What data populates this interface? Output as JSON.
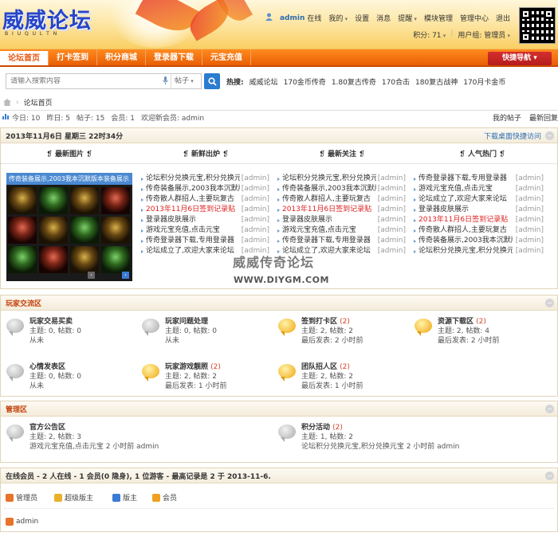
{
  "header": {
    "logo_text": "威威论坛",
    "logo_sub": "B I U Q U L T N",
    "username": "admin",
    "status": "在线",
    "links": [
      "我的",
      "设置",
      "消息",
      "提醒",
      "模块管理",
      "管理中心",
      "退出"
    ],
    "points": "积分: 71",
    "usergroup": "用户组: 管理员"
  },
  "nav": {
    "tabs": [
      "论坛首页",
      "打卡签到",
      "积分商城",
      "登录器下载",
      "元宝充值"
    ],
    "quick_nav": "快捷导航"
  },
  "search": {
    "placeholder": "请输入搜索内容",
    "type": "帖子",
    "hot_label": "热搜:",
    "hot_words": [
      "威威论坛",
      "170金币传奇",
      "1.80复古传奇",
      "170合击",
      "180复古战神",
      "170月卡金币"
    ]
  },
  "breadcrumb": {
    "current": "论坛首页"
  },
  "stats": {
    "today": "今日: 10",
    "yesterday": "昨日: 5",
    "posts": "帖子: 15",
    "members": "会员: 1",
    "welcome": "欢迎新会员: admin",
    "my_posts": "我的帖子",
    "latest": "最新回复"
  },
  "portal": {
    "date": "2013年11月6日 星期三 22时34分",
    "download_link": "下载桌面快捷访问",
    "columns": [
      "最新图片",
      "新鲜出炉",
      "最新关注",
      "人气热门"
    ],
    "pic_caption": "传奇装备展示,2003我本沉默版本装备展示",
    "col1": [
      {
        "t": "论坛积分兑换元宝,积分兑换元宝",
        "a": "[admin]",
        "red": false
      },
      {
        "t": "传奇装备展示,2003我本沉默版本",
        "a": "[admin]",
        "red": false
      },
      {
        "t": "传奇散人群招人,主要玩复古",
        "a": "[admin]",
        "red": false
      },
      {
        "t": "2013年11月6日签到记录贴",
        "a": "[admin]",
        "red": true
      },
      {
        "t": "登录器皮肤展示",
        "a": "[admin]",
        "red": false
      },
      {
        "t": "游戏元宝充值,点击元宝",
        "a": "[admin]",
        "red": false
      },
      {
        "t": "传奇登录器下载,专用登录器",
        "a": "[admin]",
        "red": false
      },
      {
        "t": "论坛成立了,欢迎大家来论坛",
        "a": "[admin]",
        "red": false
      }
    ],
    "col2": [
      {
        "t": "论坛积分兑换元宝,积分兑换元宝",
        "a": "[admin]",
        "red": false
      },
      {
        "t": "传奇装备展示,2003我本沉默版本",
        "a": "[admin]",
        "red": false
      },
      {
        "t": "传奇散人群招人,主要玩复古",
        "a": "[admin]",
        "red": false
      },
      {
        "t": "2013年11月6日签到记录贴",
        "a": "[admin]",
        "red": true
      },
      {
        "t": "登录器皮肤展示",
        "a": "[admin]",
        "red": false
      },
      {
        "t": "游戏元宝充值,点击元宝",
        "a": "[admin]",
        "red": false
      },
      {
        "t": "传奇登录器下载,专用登录器",
        "a": "[admin]",
        "red": false
      },
      {
        "t": "论坛成立了,欢迎大家来论坛",
        "a": "[admin]",
        "red": false
      }
    ],
    "col3": [
      {
        "t": "传奇登录器下载,专用登录器",
        "a": "[admin]",
        "red": false
      },
      {
        "t": "游戏元宝充值,点击元宝",
        "a": "[admin]",
        "red": false
      },
      {
        "t": "论坛成立了,欢迎大家来论坛",
        "a": "[admin]",
        "red": false
      },
      {
        "t": "登录器皮肤展示",
        "a": "[admin]",
        "red": false
      },
      {
        "t": "2013年11月6日签到记录贴",
        "a": "[admin]",
        "red": true
      },
      {
        "t": "传奇散人群招人,主要玩复古",
        "a": "[admin]",
        "red": false
      },
      {
        "t": "传奇装备展示,2003我本沉默版本",
        "a": "[admin]",
        "red": false
      },
      {
        "t": "论坛积分兑换元宝,积分兑换元宝",
        "a": "[admin]",
        "red": false
      }
    ]
  },
  "watermark": {
    "line1": "威威传奇论坛",
    "line2": "WWW.DIYGM.COM"
  },
  "player_zone": {
    "title": "玩家交流区",
    "forums": [
      {
        "name": "玩家交易买卖",
        "count": "",
        "meta1": "主题: 0, 帖数: 0",
        "meta2": "从未",
        "new": false
      },
      {
        "name": "玩家问题处理",
        "count": "",
        "meta1": "主题: 0, 帖数: 0",
        "meta2": "从未",
        "new": false
      },
      {
        "name": "签到打卡区",
        "count": "(2)",
        "meta1": "主题: 2, 帖数: 2",
        "meta2": "最后发表: 2 小时前",
        "new": true
      },
      {
        "name": "资源下载区",
        "count": "(2)",
        "meta1": "主题: 2, 帖数: 4",
        "meta2": "最后发表: 2 小时前",
        "new": true
      },
      {
        "name": "心情发表区",
        "count": "",
        "meta1": "主题: 0, 帖数: 0",
        "meta2": "从未",
        "new": false
      },
      {
        "name": "玩家游戏靓照",
        "count": "(2)",
        "meta1": "主题: 2, 帖数: 2",
        "meta2": "最后发表: 1 小时前",
        "new": true
      },
      {
        "name": "团队招人区",
        "count": "(2)",
        "meta1": "主题: 2, 帖数: 2",
        "meta2": "最后发表: 1 小时前",
        "new": true
      }
    ]
  },
  "admin_zone": {
    "title": "管理区",
    "forums": [
      {
        "name": "官方公告区",
        "count": "",
        "meta1": "主题: 2, 帖数: 3",
        "meta2": "游戏元宝充值,点击元宝 2 小时前 admin",
        "new": false
      },
      {
        "name": "积分活动",
        "count": "(2)",
        "meta1": "主题: 1, 帖数: 2",
        "meta2": "论坛积分兑换元宝,积分兑换元宝 2 小时前 admin",
        "new": false
      }
    ]
  },
  "online": {
    "title": "在线会员 - 2 人在线 - 1 会员(0 隐身), 1 位游客 - 最高记录是 2 于 2013-11-6.",
    "legend": [
      "管理员",
      "超级版主",
      "版主",
      "会员"
    ],
    "legend_colors": [
      "#e8742a",
      "#e8b12a",
      "#3a7bd5",
      "#f0a020"
    ],
    "users": [
      "admin"
    ]
  }
}
